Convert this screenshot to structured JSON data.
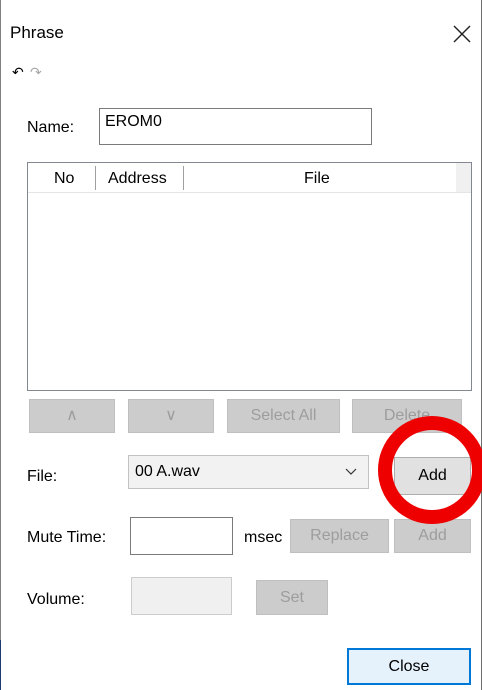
{
  "window": {
    "title": "Phrase",
    "close_icon": "close-icon",
    "undo_icon": "undo-icon",
    "redo_icon": "redo-icon"
  },
  "name": {
    "label": "Name:",
    "value": "EROM0"
  },
  "phrase_list": {
    "columns": [
      "No",
      "Address",
      "File"
    ],
    "rows": []
  },
  "list_buttons": {
    "up": "∧",
    "down": "∨",
    "select_all": "Select All",
    "delete": "Delete"
  },
  "file": {
    "label": "File:",
    "selected": "00 A.wav",
    "add": "Add"
  },
  "mute_time": {
    "label": "Mute Time:",
    "value": "",
    "unit": "msec",
    "replace": "Replace",
    "add": "Add"
  },
  "volume": {
    "label": "Volume:",
    "value": "",
    "set": "Set"
  },
  "footer": {
    "close": "Close"
  },
  "annotation": {
    "color": "#ee0000",
    "shape": "circle"
  }
}
